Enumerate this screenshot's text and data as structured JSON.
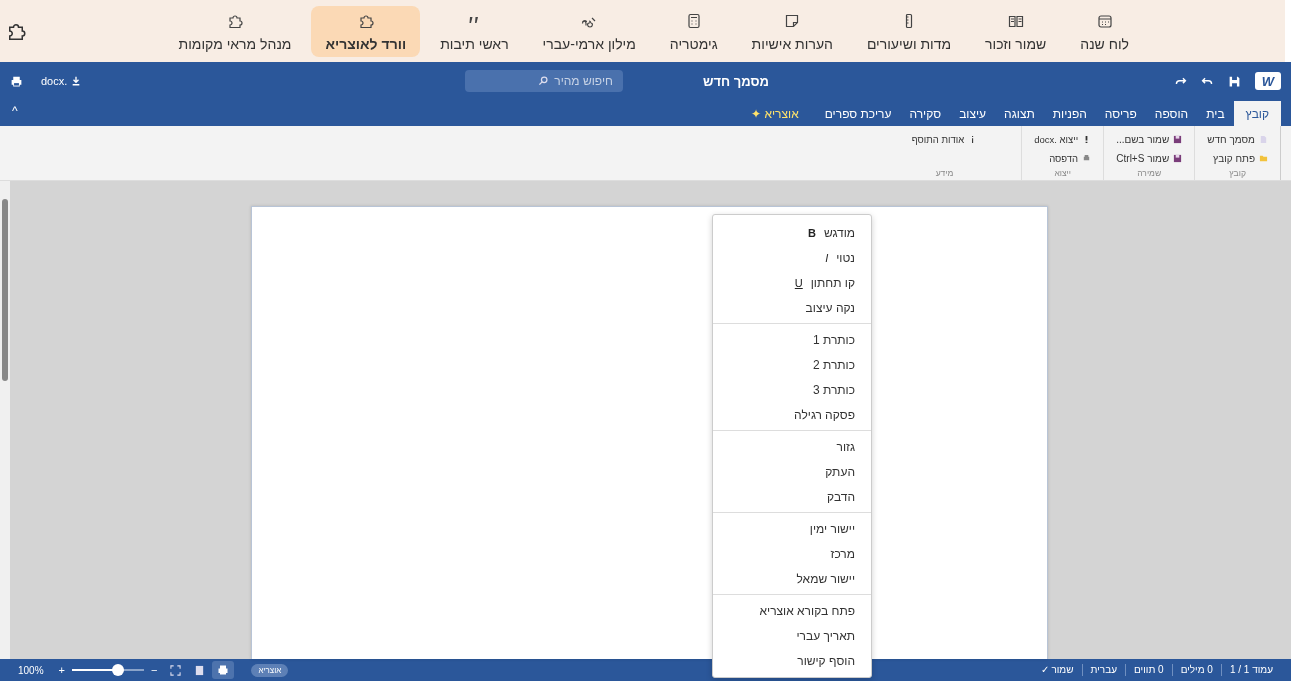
{
  "toolbar": {
    "items": [
      {
        "label": "לוח שנה",
        "selected": false
      },
      {
        "label": "שמור וזכור",
        "selected": false
      },
      {
        "label": "מדות ושיעורים",
        "selected": false
      },
      {
        "label": "הערות אישיות",
        "selected": false
      },
      {
        "label": "גימטריה",
        "selected": false
      },
      {
        "label": "מילון ארמי-עברי",
        "selected": false
      },
      {
        "label": "ראשי תיבות",
        "selected": false
      },
      {
        "label": "וורד לאוצריא",
        "selected": true
      },
      {
        "label": "מנהל מראי מקומות",
        "selected": false
      }
    ]
  },
  "title_bar": {
    "logo": "W",
    "title": "מסמך חדש",
    "search": {
      "placeholder": "חיפוש מהיר"
    },
    "export": ".docx"
  },
  "tabs": [
    {
      "label": "קובץ",
      "selected": true
    },
    {
      "label": "בית",
      "selected": false
    },
    {
      "label": "הוספה",
      "selected": false
    },
    {
      "label": "פריסה",
      "selected": false
    },
    {
      "label": "הפניות",
      "selected": false
    },
    {
      "label": "תצוגה",
      "selected": false
    },
    {
      "label": "עיצוב",
      "selected": false
    },
    {
      "label": "סקירה",
      "selected": false
    },
    {
      "label": "עריכת ספרים",
      "selected": false
    },
    {
      "label": "אוצריא ✦",
      "selected": false
    }
  ],
  "collapse": "^",
  "ribbon": [
    {
      "name": "קובץ",
      "buttons": [
        "מסמך חדש",
        "פתח קובץ"
      ]
    },
    {
      "name": "שמירה",
      "buttons": [
        "שמור בשם...",
        "שמור Ctrl+S"
      ]
    },
    {
      "name": "ייצוא",
      "buttons": [
        "ייצוא .docx",
        "הדפסה"
      ]
    },
    {
      "name": "מידע",
      "buttons": [
        "אודות התוסף"
      ]
    }
  ],
  "context_menu": [
    [
      {
        "label": "מודגש",
        "glyph": "B"
      },
      {
        "label": "נטוי",
        "glyph": "I"
      },
      {
        "label": "קו תחתון",
        "glyph": "U"
      },
      {
        "label": "נקה עיצוב"
      }
    ],
    [
      {
        "label": "כותרת 1"
      },
      {
        "label": "כותרת 2"
      },
      {
        "label": "כותרת 3"
      },
      {
        "label": "פסקה רגילה"
      }
    ],
    [
      {
        "label": "גזור"
      },
      {
        "label": "העתק"
      },
      {
        "label": "הדבק"
      }
    ],
    [
      {
        "label": "יישור ימין"
      },
      {
        "label": "מרכז"
      },
      {
        "label": "יישור שמאל"
      }
    ],
    [
      {
        "label": "פתח בקורא אוצריא"
      },
      {
        "label": "תאריך עברי"
      },
      {
        "label": "הוסף קישור"
      }
    ]
  ],
  "status_bar": {
    "items": [
      "עמוד 1 / 1",
      "0 מילים",
      "0 תווים",
      "עברית",
      "שמור ✓"
    ],
    "zoom": "100%",
    "zoom_in": "+",
    "zoom_out": "−",
    "zoom_slider": {
      "level": 0.64
    },
    "badge": "אוצריא"
  }
}
